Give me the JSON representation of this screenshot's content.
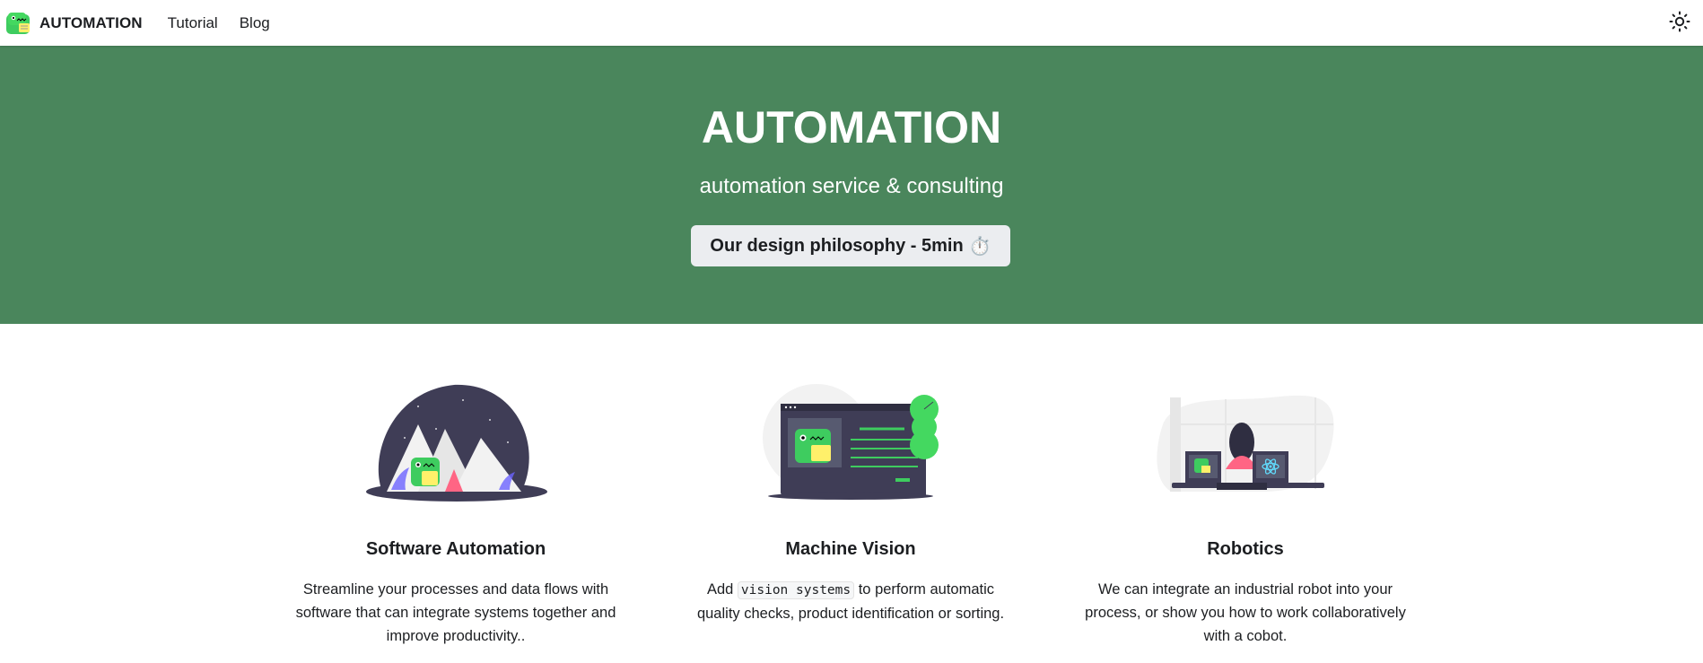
{
  "navbar": {
    "brand_title": "AUTOMATION",
    "links": [
      "Tutorial",
      "Blog"
    ],
    "theme_toggle_icon": "sun-icon"
  },
  "hero": {
    "title": "AUTOMATION",
    "subtitle": "automation service & consulting",
    "button_label": "Our design philosophy - 5min",
    "button_icon": "⏱️",
    "background_color": "#4a865c"
  },
  "features": [
    {
      "title": "Software Automation",
      "description": "Streamline your processes and data flows with software that can integrate systems together and improve productivity..",
      "illustration": "mountains-dino-illustration"
    },
    {
      "title": "Machine Vision",
      "desc_prefix": "Add",
      "desc_code": "vision systems",
      "desc_suffix": "to perform automatic quality checks, product identification or sorting.",
      "illustration": "monitor-dino-illustration"
    },
    {
      "title": "Robotics",
      "description": "We can integrate an industrial robot into your process, or show you how to work collaboratively with a cobot.",
      "illustration": "person-desk-illustration"
    }
  ]
}
